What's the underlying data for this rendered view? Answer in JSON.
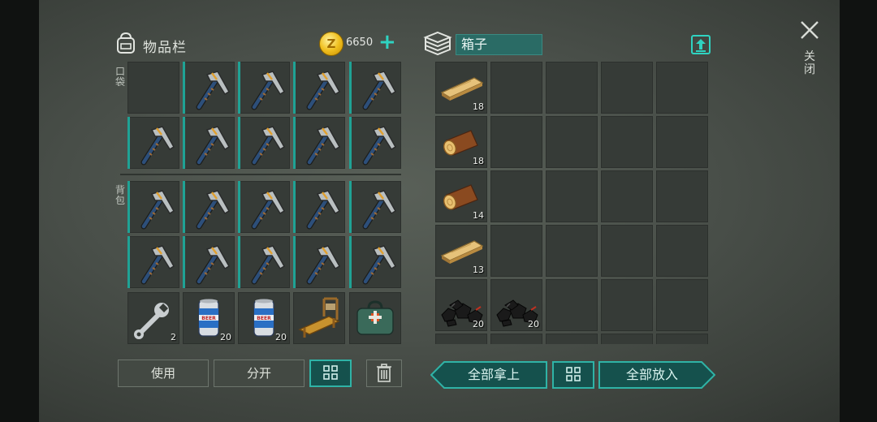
{
  "inventory": {
    "title": "物品栏",
    "coins": "6650",
    "pocket_label": "口袋",
    "backpack_label": "背包"
  },
  "items": {
    "bottom_row": [
      {
        "icon": "wrench-icon",
        "count": "2"
      },
      {
        "icon": "beer-can-icon",
        "count": "20"
      },
      {
        "icon": "beer-can-icon",
        "count": "20"
      },
      {
        "icon": "workbench-icon",
        "count": ""
      },
      {
        "icon": "medkit-bag-icon",
        "count": ""
      }
    ],
    "pickaxe_icon": "pickaxe-icon"
  },
  "buttons": {
    "use": "使用",
    "split": "分开",
    "take_all": "全部拿上",
    "put_all": "全部放入"
  },
  "chest": {
    "name": "箱子",
    "items": [
      {
        "icon": "plank-icon",
        "count": "18"
      },
      {
        "icon": "log-icon",
        "count": "18"
      },
      {
        "icon": "log-icon",
        "count": "14"
      },
      {
        "icon": "plank-icon",
        "count": "13"
      },
      {
        "icon": "coal-icon",
        "count": "20"
      },
      {
        "icon": "coal-icon",
        "count": "20"
      }
    ]
  },
  "close_label": "关闭",
  "colors": {
    "accent": "#2fb3a6",
    "slot": "#363b37",
    "chest_name_bg": "#2a6b65"
  }
}
